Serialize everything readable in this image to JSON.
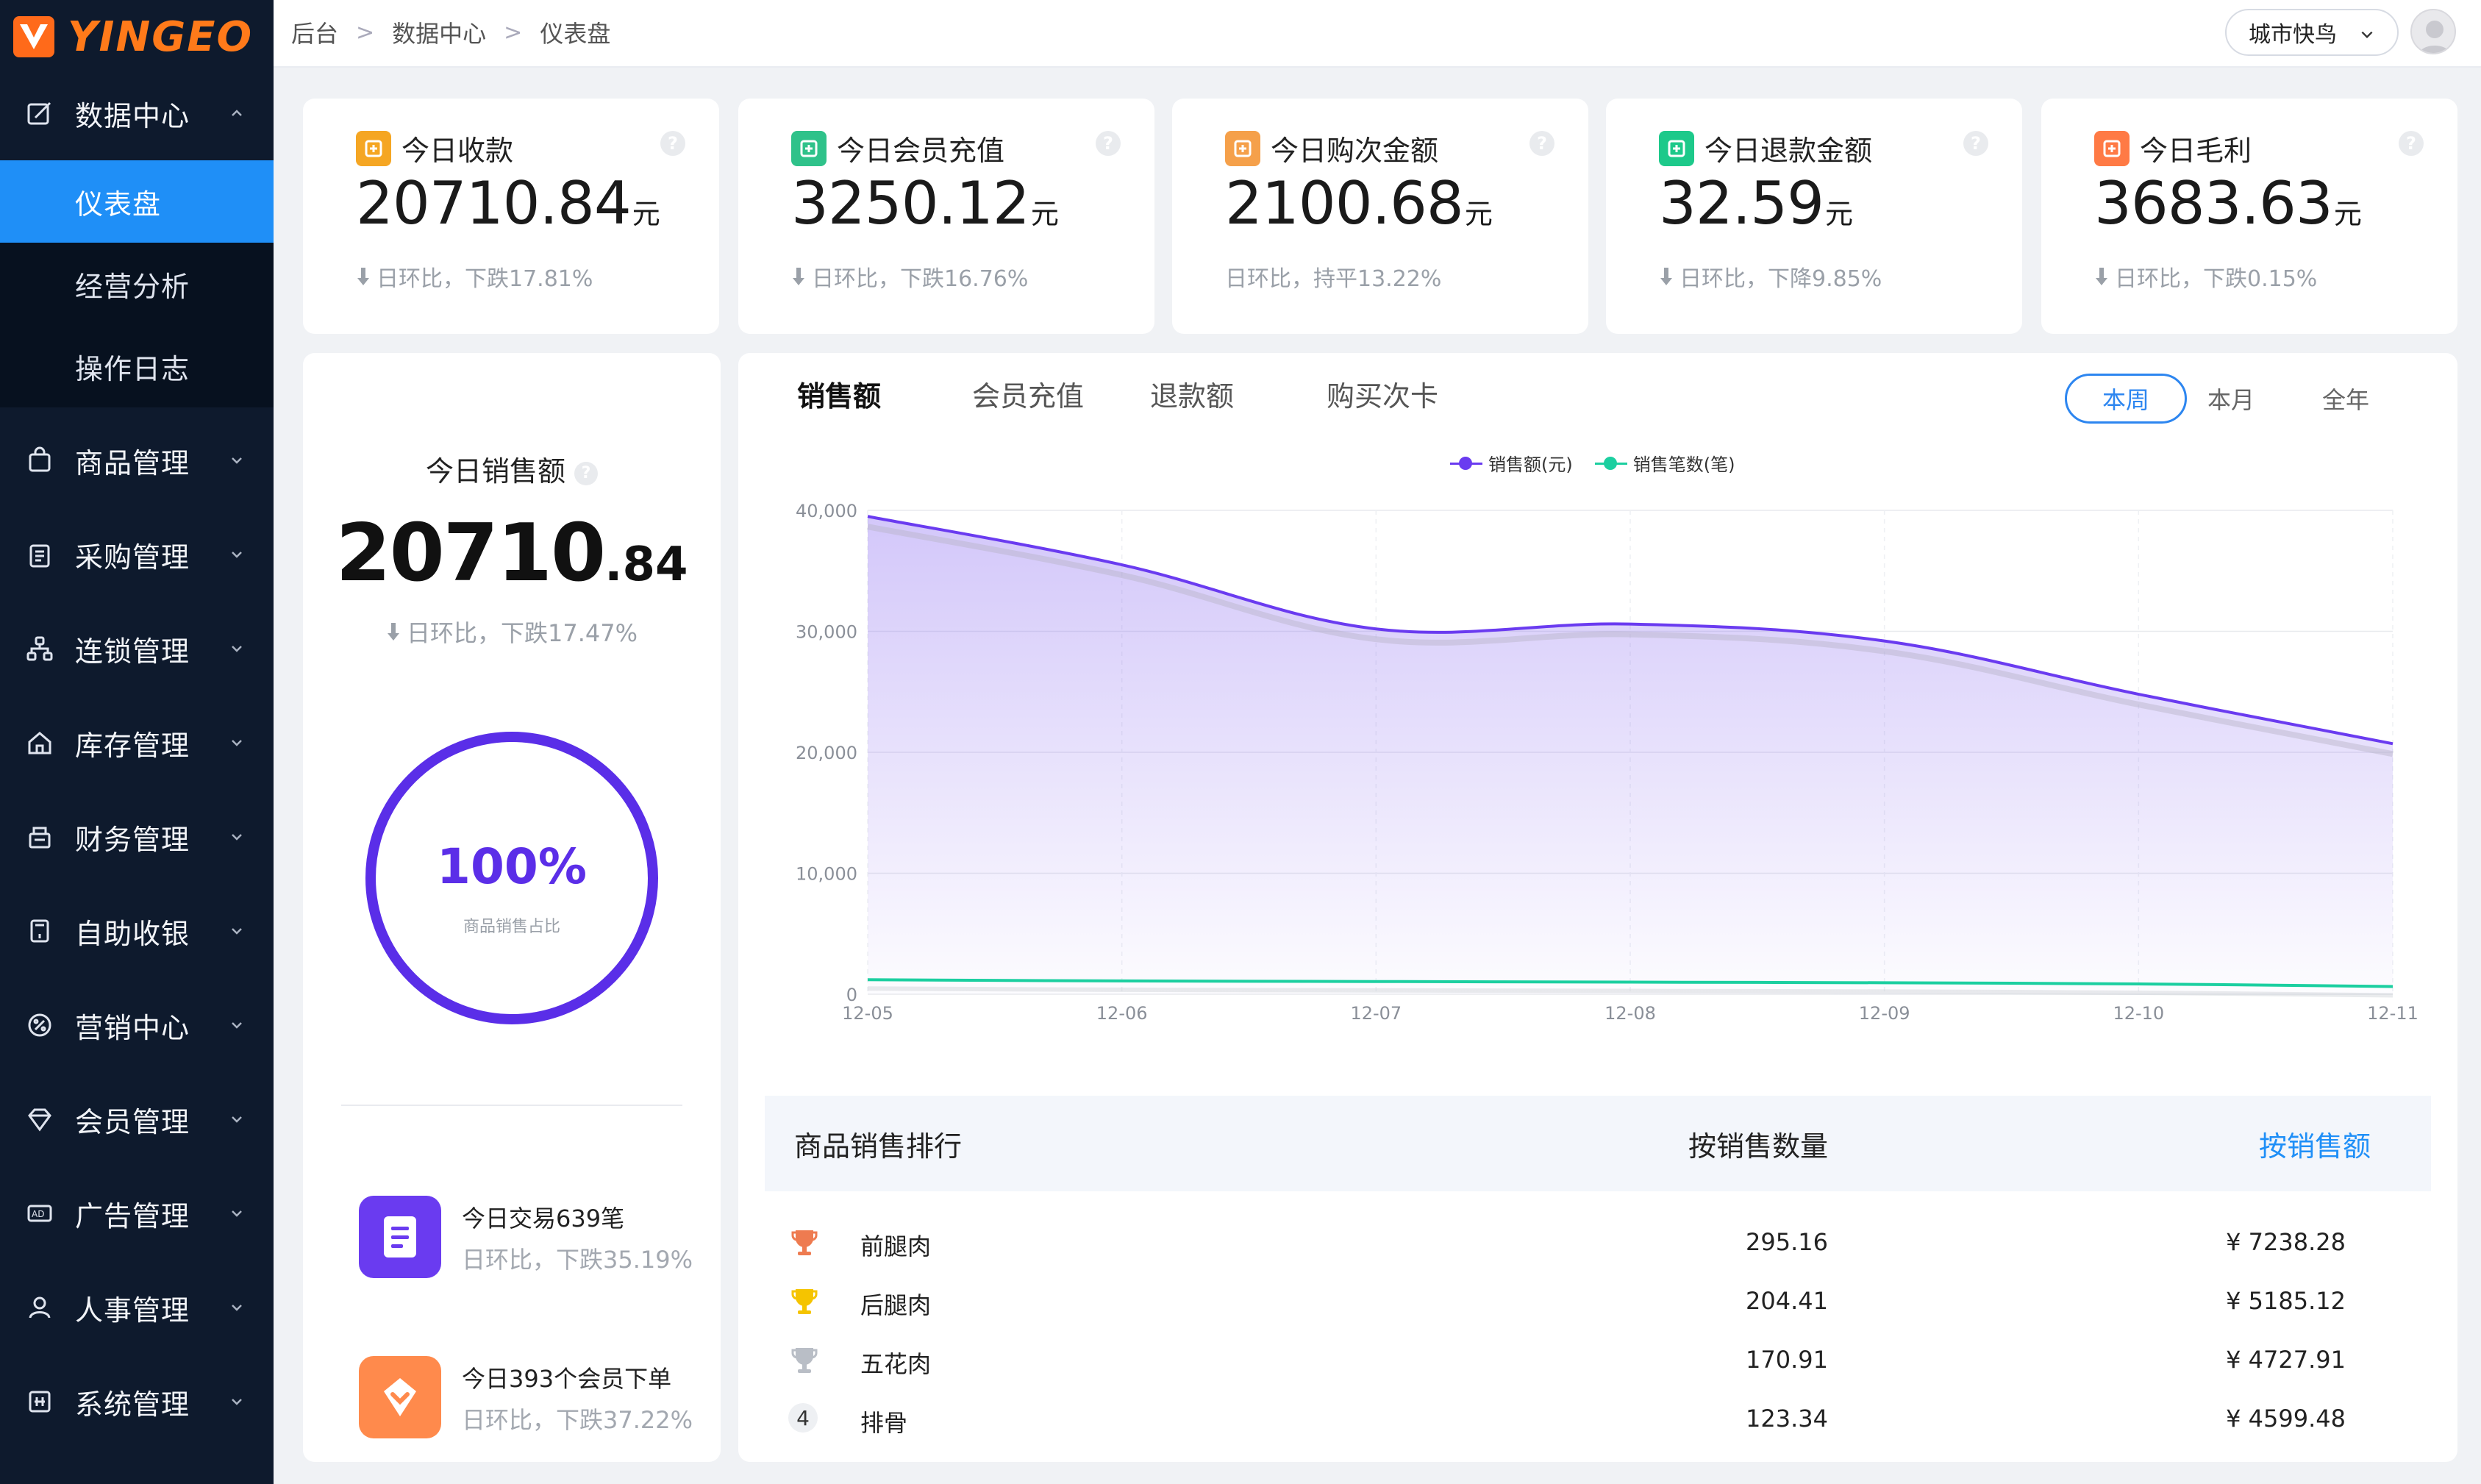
{
  "brand": {
    "logo_text": "YINGEO"
  },
  "sidebar": {
    "groups": [
      {
        "label": "数据中心",
        "icon": "edit-chart-icon",
        "expanded": true,
        "children": [
          {
            "label": "仪表盘",
            "active": true
          },
          {
            "label": "经营分析"
          },
          {
            "label": "操作日志"
          }
        ]
      },
      {
        "label": "商品管理",
        "icon": "bag-icon"
      },
      {
        "label": "采购管理",
        "icon": "clipboard-icon"
      },
      {
        "label": "连锁管理",
        "icon": "org-tree-icon"
      },
      {
        "label": "库存管理",
        "icon": "home-icon"
      },
      {
        "label": "财务管理",
        "icon": "cash-register-icon"
      },
      {
        "label": "自助收银",
        "icon": "self-checkout-icon"
      },
      {
        "label": "营销中心",
        "icon": "percent-badge-icon"
      },
      {
        "label": "会员管理",
        "icon": "diamond-icon"
      },
      {
        "label": "广告管理",
        "icon": "ad-icon"
      },
      {
        "label": "人事管理",
        "icon": "user-icon"
      },
      {
        "label": "系统管理",
        "icon": "grid-settings-icon"
      }
    ]
  },
  "topbar": {
    "breadcrumb": [
      "后台",
      "数据中心",
      "仪表盘"
    ],
    "city": "城市快鸟"
  },
  "stats": [
    {
      "title": "今日收款",
      "value": "20710.84",
      "unit": "元",
      "compare": "日环比，下跌17.81%",
      "trend": "down",
      "icon": "yen-note-icon",
      "color": "#f5a623"
    },
    {
      "title": "今日会员充值",
      "value": "3250.12",
      "unit": "元",
      "compare": "日环比，下跌16.76%",
      "trend": "down",
      "icon": "recharge-doc-icon",
      "color": "#2fc28a"
    },
    {
      "title": "今日购次金额",
      "value": "2100.68",
      "unit": "元",
      "compare": "日环比，持平13.22%",
      "trend": "flat",
      "icon": "calendar-chart-icon",
      "color": "#f5a04a"
    },
    {
      "title": "今日退款金额",
      "value": "32.59",
      "unit": "元",
      "compare": "日环比，下降9.85%",
      "trend": "down",
      "icon": "refund-coin-icon",
      "color": "#1dc98a"
    },
    {
      "title": "今日毛利",
      "value": "3683.63",
      "unit": "元",
      "compare": "日环比，下跌0.15%",
      "trend": "down",
      "icon": "money-bag-icon",
      "color": "#ff7a45"
    }
  ],
  "sales": {
    "title": "今日销售额",
    "value_int": "20710",
    "value_dec": ".84",
    "compare": "日环比，下跌17.47%",
    "ring_percent": "100%",
    "ring_fraction": 1.0,
    "ring_label": "商品销售占比",
    "ring_color": "#5a2ee8",
    "minis": [
      {
        "title": "今日交易639笔",
        "compare": "日环比，下跌35.19%",
        "icon": "receipt-icon",
        "color": "#6a3bf0"
      },
      {
        "title": "今日393个会员下单",
        "compare": "日环比，下跌37.22%",
        "icon": "member-diamond-icon",
        "color": "#ff8a4c"
      }
    ]
  },
  "chart_tabs": [
    "销售额",
    "会员充值",
    "退款额",
    "购买次卡"
  ],
  "periods": [
    "本周",
    "本月",
    "全年"
  ],
  "chart_data": {
    "type": "area",
    "x": [
      "12-05",
      "12-06",
      "12-07",
      "12-08",
      "12-09",
      "12-10",
      "12-11"
    ],
    "series": [
      {
        "name": "销售额(元)",
        "values": [
          39500,
          35500,
          30200,
          30600,
          29200,
          24800,
          20710
        ],
        "color": "#6a3bf0"
      },
      {
        "name": "销售笔数(笔)",
        "values": [
          1200,
          1100,
          1050,
          1000,
          950,
          850,
          639
        ],
        "color": "#1ccfa0"
      }
    ],
    "ylim": [
      0,
      40000
    ],
    "yticks": [
      "40,000",
      "30,000",
      "20,000",
      "10,000",
      "0"
    ],
    "ytick_values": [
      40000,
      30000,
      20000,
      10000,
      0
    ],
    "grid": true,
    "legend": "top"
  },
  "ranking": {
    "title": "商品销售排行",
    "by_qty": "按销售数量",
    "by_amount": "按销售额",
    "rows": [
      {
        "rank": "1",
        "name": "前腿肉",
        "qty": "295.16",
        "amount": "¥ 7238.28",
        "medal": "bronze-trophy-icon",
        "color": "#ee7b50"
      },
      {
        "rank": "2",
        "name": "后腿肉",
        "qty": "204.41",
        "amount": "¥ 5185.12",
        "medal": "gold-trophy-icon",
        "color": "#f5c400"
      },
      {
        "rank": "3",
        "name": "五花肉",
        "qty": "170.91",
        "amount": "¥ 4727.91",
        "medal": "silver-trophy-icon",
        "color": "#b9bec6"
      },
      {
        "rank": "4",
        "name": "排骨",
        "qty": "123.34",
        "amount": "¥ 4599.48",
        "medal": "",
        "color": ""
      }
    ]
  }
}
